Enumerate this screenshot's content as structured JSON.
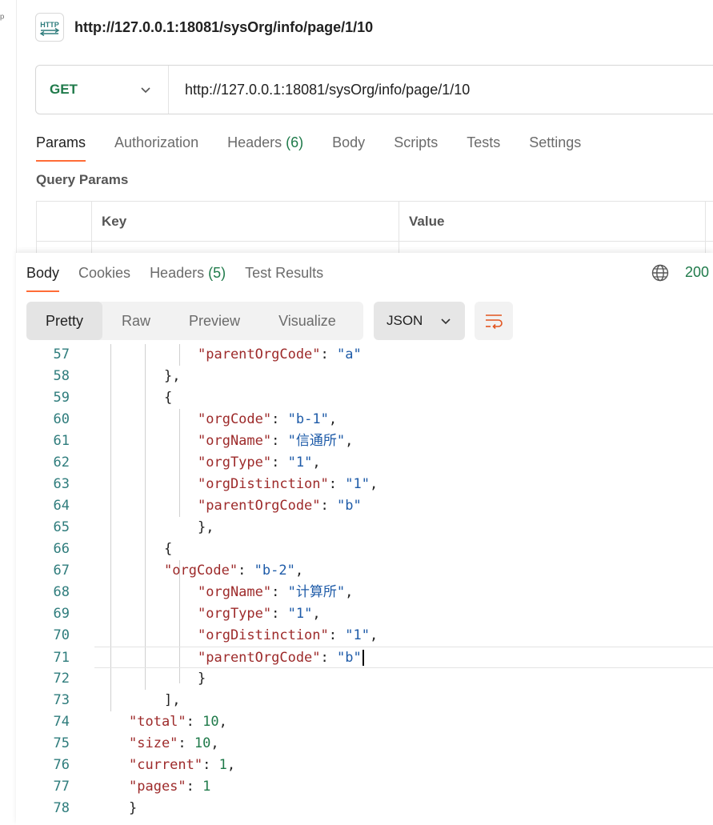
{
  "request": {
    "icon_label": "HTTP",
    "title": "http://127.0.0.1:18081/sysOrg/info/page/1/10",
    "method": "GET",
    "url": "http://127.0.0.1:18081/sysOrg/info/page/1/10"
  },
  "request_tabs": [
    {
      "label": "Params",
      "count": ""
    },
    {
      "label": "Authorization",
      "count": ""
    },
    {
      "label": "Headers",
      "count": "(6)"
    },
    {
      "label": "Body",
      "count": ""
    },
    {
      "label": "Scripts",
      "count": ""
    },
    {
      "label": "Tests",
      "count": ""
    },
    {
      "label": "Settings",
      "count": ""
    }
  ],
  "query_params": {
    "label": "Query Params",
    "columns": [
      "Key",
      "Value"
    ]
  },
  "response": {
    "tabs": [
      {
        "label": "Body",
        "count": ""
      },
      {
        "label": "Cookies",
        "count": ""
      },
      {
        "label": "Headers",
        "count": "(5)"
      },
      {
        "label": "Test Results",
        "count": ""
      }
    ],
    "status": "200",
    "formats": [
      "Pretty",
      "Raw",
      "Preview",
      "Visualize"
    ],
    "language": "JSON"
  },
  "code_lines": [
    {
      "n": "57",
      "text": "\"parentOrgCode\": \"a\""
    },
    {
      "n": "58",
      "text": "},"
    },
    {
      "n": "59",
      "text": "{"
    },
    {
      "n": "60",
      "text": "\"orgCode\": \"b-1\","
    },
    {
      "n": "61",
      "text": "\"orgName\": \"信通所\","
    },
    {
      "n": "62",
      "text": "\"orgType\": \"1\","
    },
    {
      "n": "63",
      "text": "\"orgDistinction\": \"1\","
    },
    {
      "n": "64",
      "text": "\"parentOrgCode\": \"b\""
    },
    {
      "n": "65",
      "text": "},"
    },
    {
      "n": "66",
      "text": "{"
    },
    {
      "n": "67",
      "text": "\"orgCode\": \"b-2\","
    },
    {
      "n": "68",
      "text": "\"orgName\": \"计算所\","
    },
    {
      "n": "69",
      "text": "\"orgType\": \"1\","
    },
    {
      "n": "70",
      "text": "\"orgDistinction\": \"1\","
    },
    {
      "n": "71",
      "text": "\"parentOrgCode\": \"b\""
    },
    {
      "n": "72",
      "text": "}"
    },
    {
      "n": "73",
      "text": "],"
    },
    {
      "n": "74",
      "text": "\"total\": 10,"
    },
    {
      "n": "75",
      "text": "\"size\": 10,"
    },
    {
      "n": "76",
      "text": "\"current\": 1,"
    },
    {
      "n": "77",
      "text": "\"pages\": 1"
    },
    {
      "n": "78",
      "text": "}"
    }
  ],
  "colors": {
    "accent": "#ff6c37",
    "method": "#1f7a4a",
    "json_key": "#9d2a2a",
    "json_string": "#1e5ba8",
    "json_number": "#1f7a4a"
  }
}
